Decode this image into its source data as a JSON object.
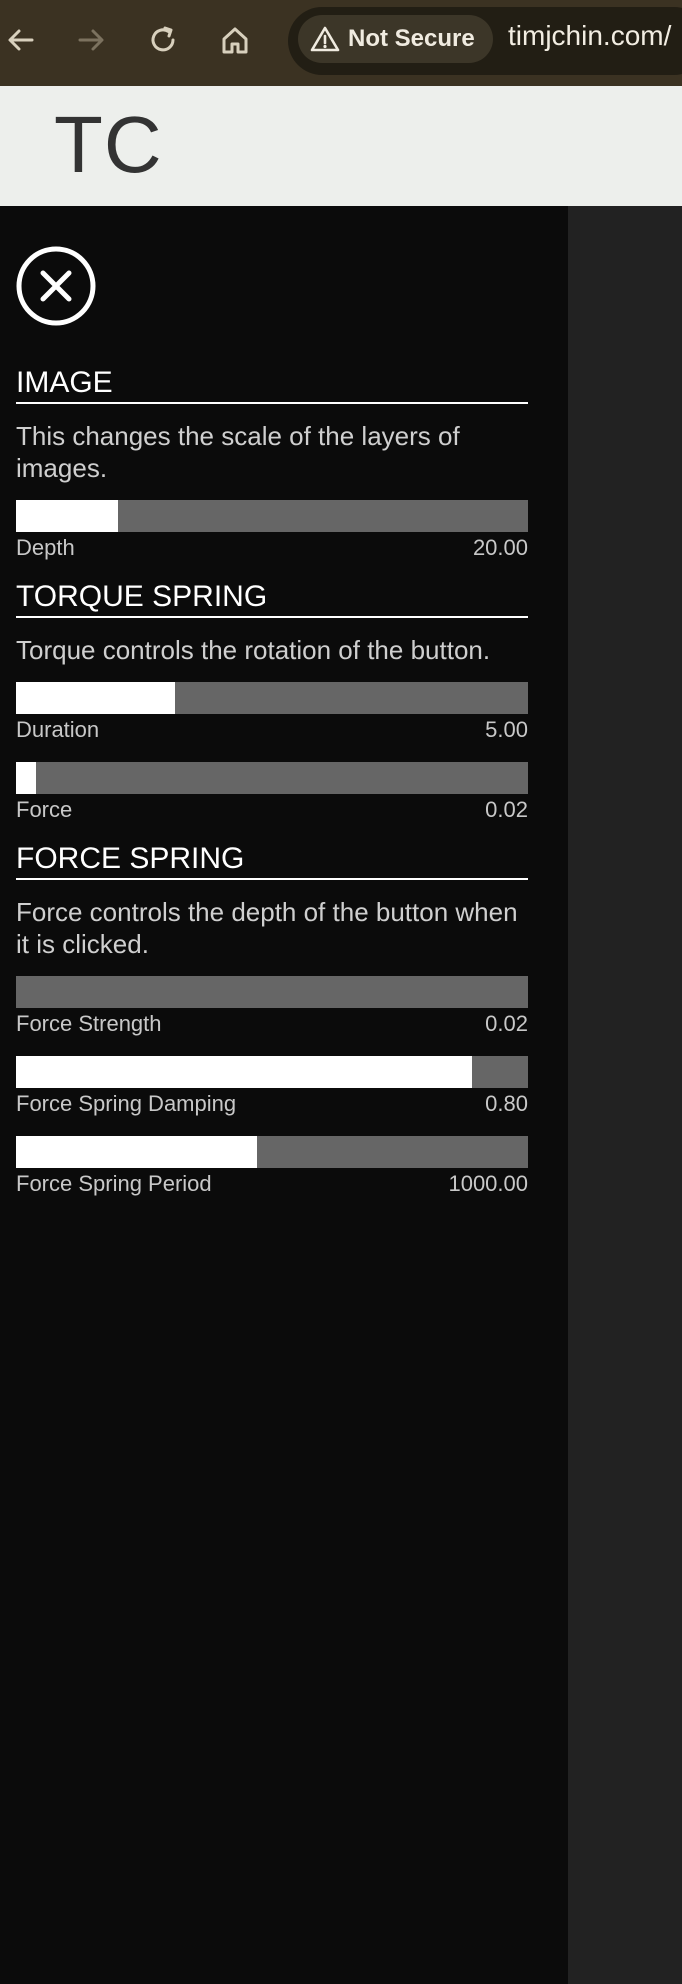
{
  "browser": {
    "security_label": "Not Secure",
    "url": "timjchin.com/",
    "icons": [
      "back-arrow-icon",
      "forward-arrow-icon",
      "reload-icon",
      "home-icon",
      "warning-icon"
    ]
  },
  "site": {
    "logo": "TC"
  },
  "panel": {
    "close_icon": "close-circle-icon",
    "sections": [
      {
        "title": "IMAGE",
        "description": "This changes the scale of the layers of images.",
        "sliders": [
          {
            "label": "Depth",
            "value": "20.00",
            "fill": 0.2
          }
        ]
      },
      {
        "title": "TORQUE SPRING",
        "description": "Torque controls the rotation of the button.",
        "sliders": [
          {
            "label": "Duration",
            "value": "5.00",
            "fill": 0.31
          },
          {
            "label": "Force",
            "value": "0.02",
            "fill": 0.04
          }
        ]
      },
      {
        "title": "FORCE SPRING",
        "description": "Force controls the depth of the button when it is clicked.",
        "sliders": [
          {
            "label": "Force Strength",
            "value": "0.02",
            "fill": 0.0
          },
          {
            "label": "Force Spring Damping",
            "value": "0.80",
            "fill": 0.89
          },
          {
            "label": "Force Spring Period",
            "value": "1000.00",
            "fill": 0.47
          }
        ]
      }
    ]
  },
  "colors": {
    "toolbar": "#3b3222",
    "header": "#edefec",
    "panel": "#0b0b0b",
    "slider_track": "#666666",
    "slider_fill": "#ffffff"
  }
}
